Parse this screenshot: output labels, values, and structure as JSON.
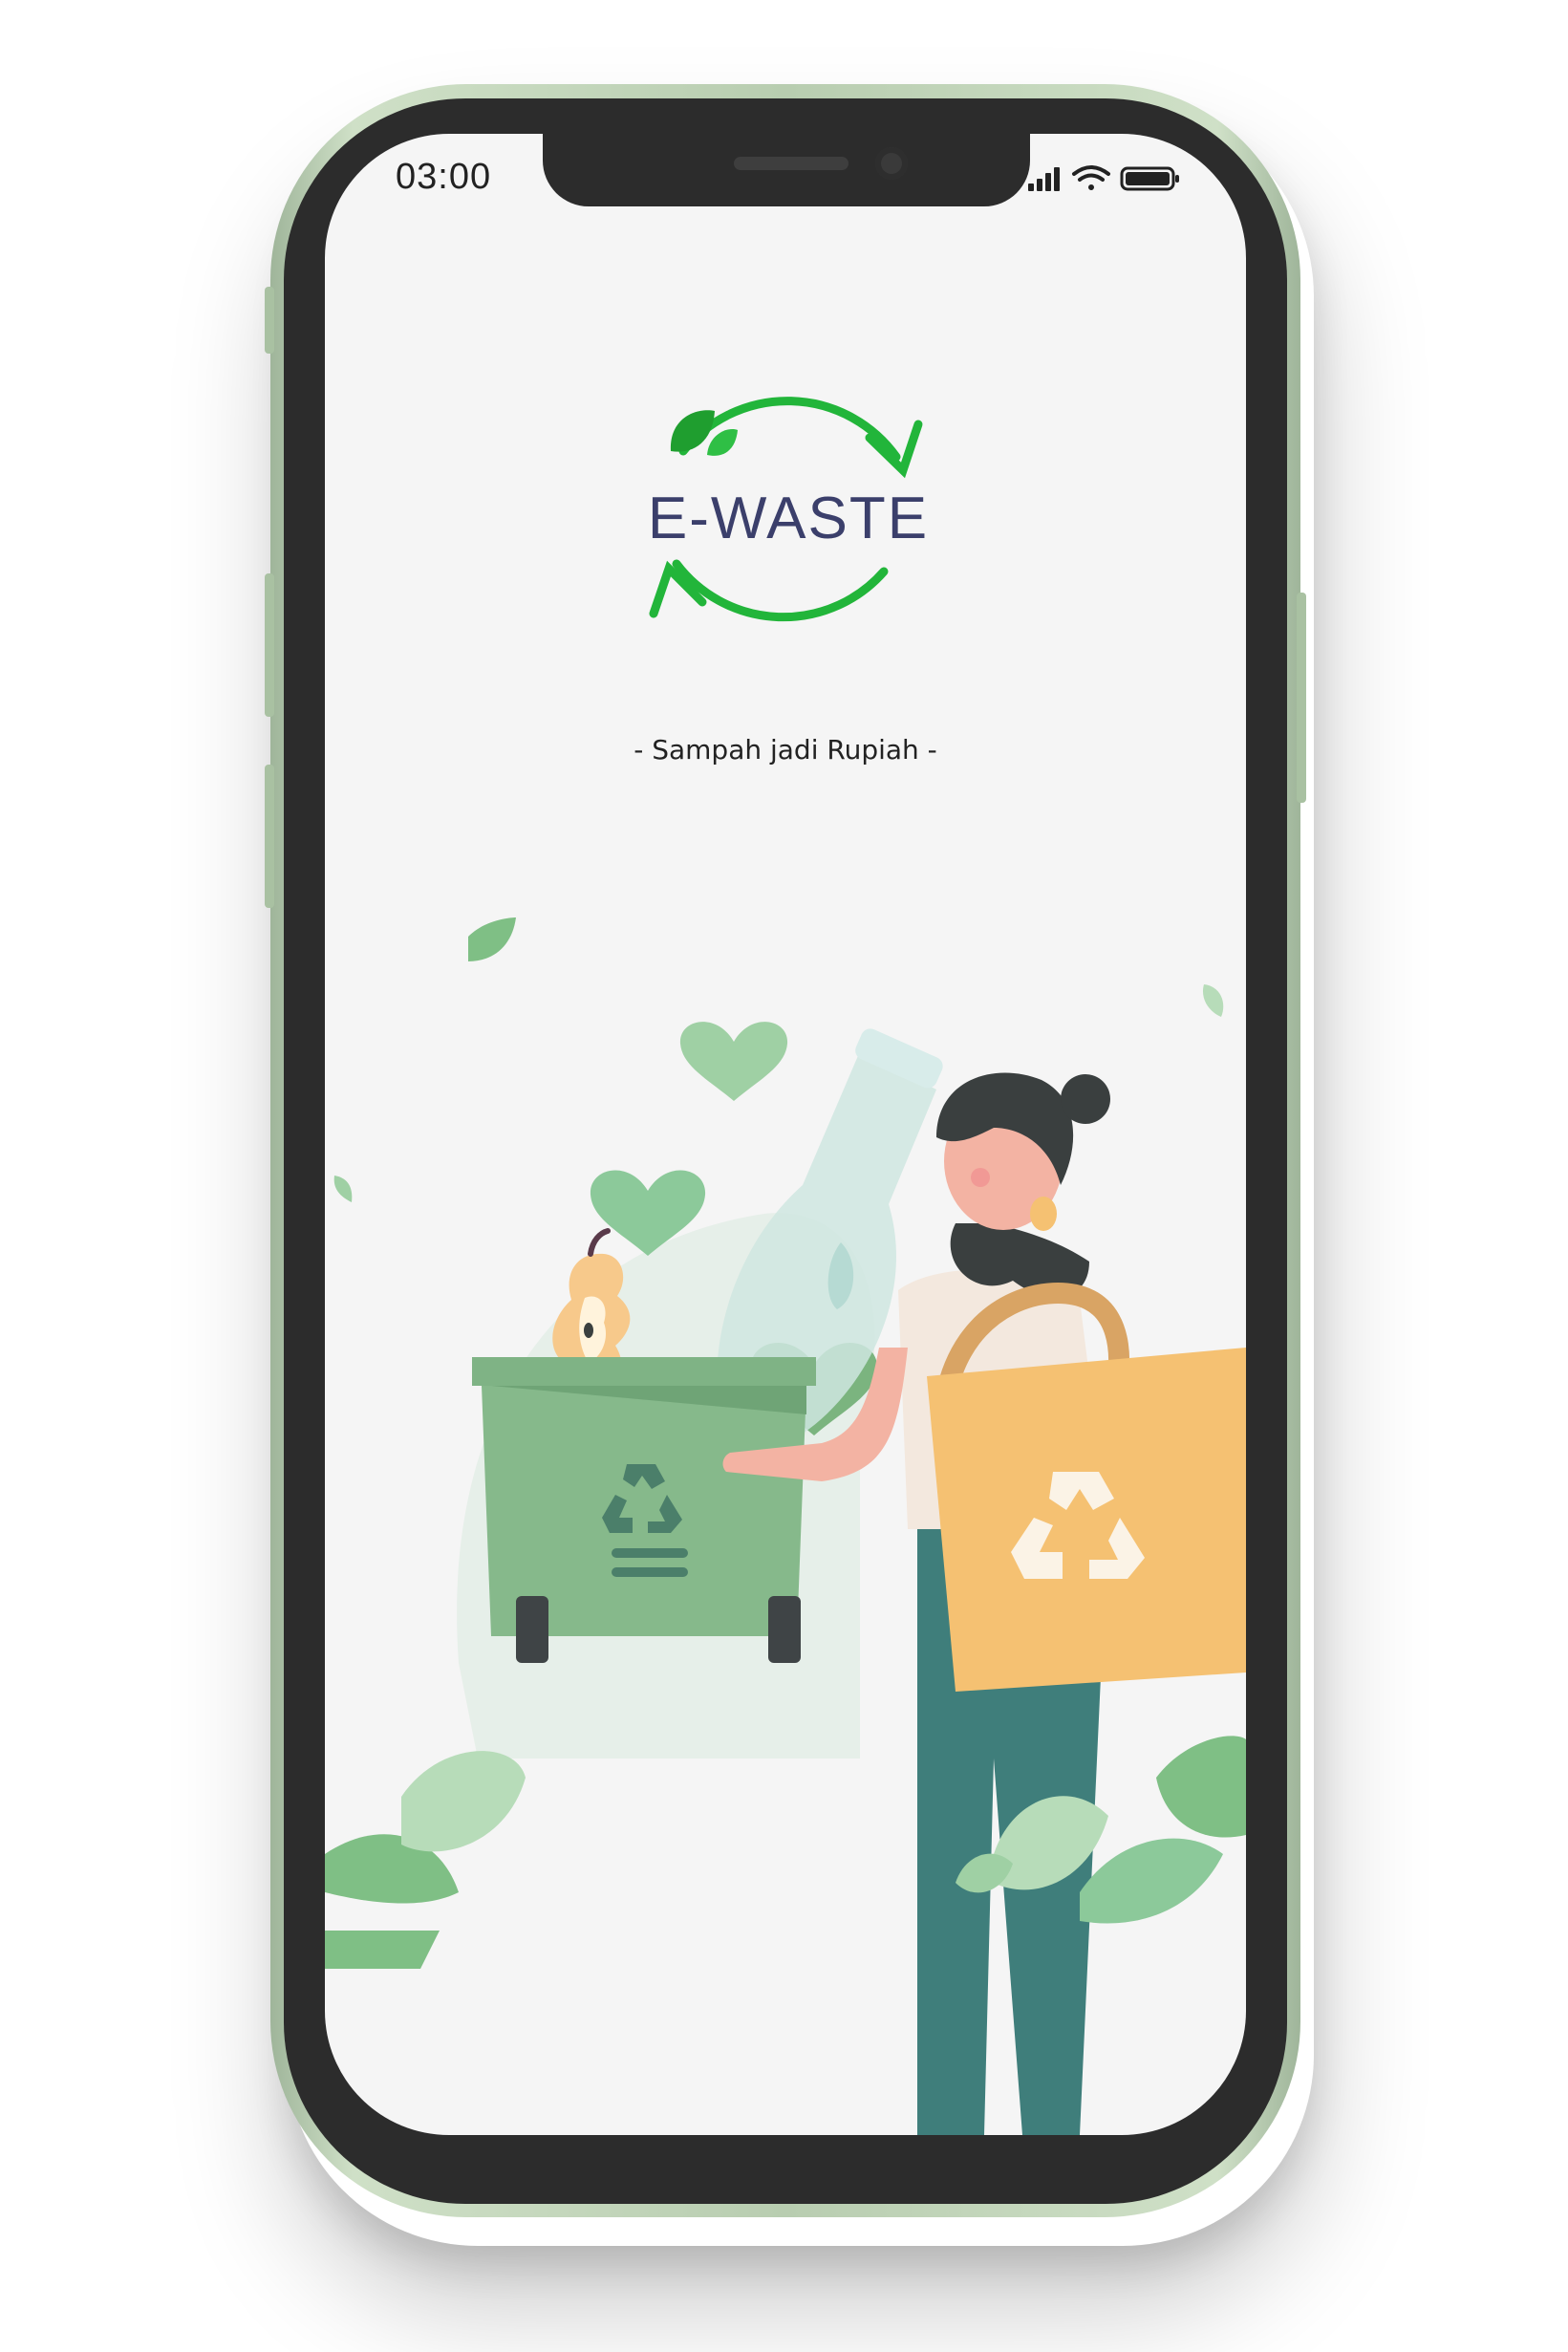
{
  "status_bar": {
    "time": "03:00",
    "icons": [
      "signal-icon",
      "wifi-icon",
      "battery-icon"
    ]
  },
  "logo": {
    "text": "E-WASTE",
    "colors": {
      "arrows": "#22b53a",
      "text": "#3b3f6b",
      "leaf": "#1f9e2f"
    }
  },
  "tagline": "- Sampah jadi Rupiah -",
  "illustration": {
    "name": "woman-recycling-illustration",
    "colors": {
      "bin": "#86b98b",
      "bin_dark": "#4b7f6a",
      "bag": "#f5c172",
      "pants": "#3f7e7b",
      "hair": "#3a3f3f",
      "skin": "#f3b3a3",
      "leaf": "#7fbf85",
      "heart": "#8cc99a"
    }
  }
}
